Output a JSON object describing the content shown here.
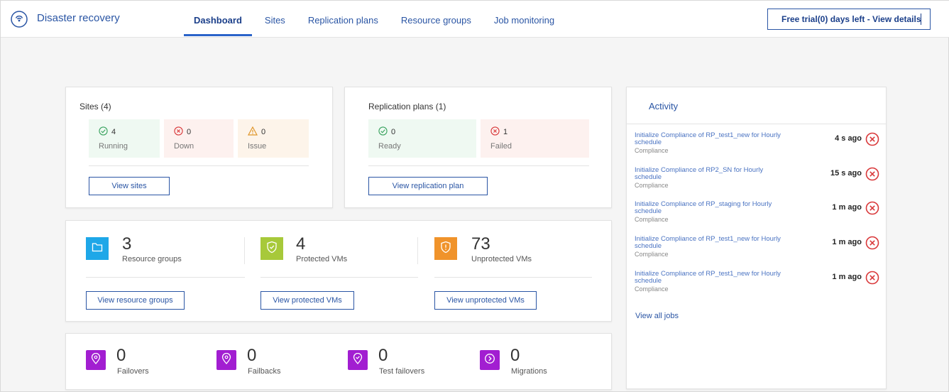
{
  "app": {
    "title": "Disaster recovery"
  },
  "nav": {
    "tabs": [
      {
        "label": "Dashboard",
        "active": true
      },
      {
        "label": "Sites"
      },
      {
        "label": "Replication plans"
      },
      {
        "label": "Resource groups"
      },
      {
        "label": "Job monitoring"
      }
    ],
    "trial_label": "Free trial(0) days left - View details"
  },
  "sites": {
    "title": "Sites (4)",
    "running": {
      "count": "4",
      "label": "Running"
    },
    "down": {
      "count": "0",
      "label": "Down"
    },
    "issue": {
      "count": "0",
      "label": "Issue"
    },
    "button": "View sites"
  },
  "replication": {
    "title": "Replication plans (1)",
    "ready": {
      "count": "0",
      "label": "Ready"
    },
    "failed": {
      "count": "1",
      "label": "Failed"
    },
    "button": "View replication plan"
  },
  "inventory": {
    "resource_groups": {
      "count": "3",
      "label": "Resource groups",
      "button": "View resource groups"
    },
    "protected": {
      "count": "4",
      "label": "Protected VMs",
      "button": "View protected VMs"
    },
    "unprotected": {
      "count": "73",
      "label": "Unprotected VMs",
      "button": "View unprotected VMs"
    }
  },
  "operations": {
    "failovers": {
      "count": "0",
      "label": "Failovers"
    },
    "failbacks": {
      "count": "0",
      "label": "Failbacks"
    },
    "test_failovers": {
      "count": "0",
      "label": "Test failovers"
    },
    "migrations": {
      "count": "0",
      "label": "Migrations"
    }
  },
  "activity": {
    "title": "Activity",
    "items": [
      {
        "line1": "Initialize Compliance of RP_test1_new for Hourly",
        "line2": "schedule",
        "sub": "Compliance",
        "time": "4 s ago"
      },
      {
        "line1": "Initialize Compliance of RP2_SN for Hourly",
        "line2": "schedule",
        "sub": "Compliance",
        "time": "15 s ago"
      },
      {
        "line1": "Initialize Compliance of RP_staging for Hourly",
        "line2": "schedule",
        "sub": "Compliance",
        "time": "1 m ago"
      },
      {
        "line1": "Initialize Compliance of RP_test1_new for Hourly",
        "line2": "schedule",
        "sub": "Compliance",
        "time": "1 m ago"
      },
      {
        "line1": "Initialize Compliance of RP_test1_new for Hourly",
        "line2": "schedule",
        "sub": "Compliance",
        "time": "1 m ago"
      }
    ],
    "view_all": "View all jobs"
  },
  "colors": {
    "brand_blue": "#2a55a4",
    "success": "#3aa35f",
    "error": "#d9383a",
    "warning": "#e0962a",
    "resource_tile": "#1ea7e8",
    "protected_tile": "#a7c93a",
    "unprotected_tile": "#f0932b",
    "operations_tile": "#a21ed1"
  }
}
